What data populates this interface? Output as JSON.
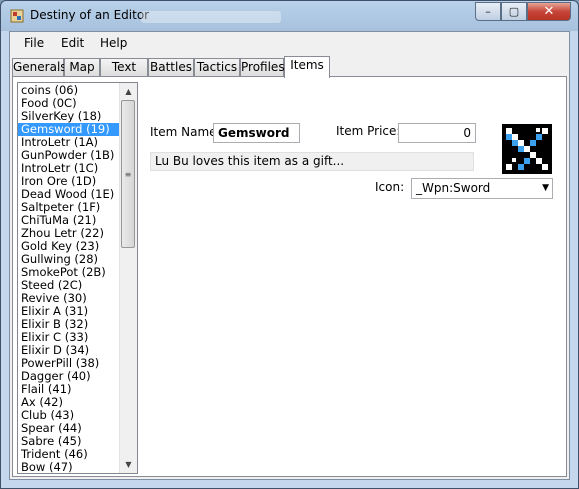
{
  "window": {
    "title": "Destiny of an Editor",
    "controls": {
      "minimize": "–",
      "maximize": "▢",
      "close": "✕"
    }
  },
  "menu": [
    "File",
    "Edit",
    "Help"
  ],
  "tabs": [
    {
      "label": "Generals",
      "active": false
    },
    {
      "label": "Map",
      "active": false
    },
    {
      "label": "Text",
      "active": false
    },
    {
      "label": "Battles",
      "active": false
    },
    {
      "label": "Tactics",
      "active": false
    },
    {
      "label": "Profiles",
      "active": false
    },
    {
      "label": "Items",
      "active": true
    }
  ],
  "items_list": [
    "coins (06)",
    "Food (0C)",
    "SilverKey (18)",
    "Gemsword (19)",
    "IntroLetr (1A)",
    "GunPowder (1B)",
    "IntroLetr (1C)",
    "Iron Ore (1D)",
    "Dead Wood (1E)",
    "Saltpeter (1F)",
    "ChiTuMa (21)",
    "Zhou Letr (22)",
    "Gold Key (23)",
    "Gullwing (28)",
    "SmokePot (2B)",
    "Steed (2C)",
    "Revive (30)",
    "Elixir A (31)",
    "Elixir B (32)",
    "Elixir C (33)",
    "Elixir D (34)",
    "PowerPill (38)",
    "Dagger (40)",
    "Flail (41)",
    "Ax (42)",
    "Club (43)",
    "Spear (44)",
    "Sabre (45)",
    "Trident (46)",
    "Bow (47)"
  ],
  "selected_item": "Gemsword (19)",
  "item_form": {
    "name_label": "Item Name:",
    "name_value": "Gemsword",
    "price_label": "Item Price:",
    "price_value": "0",
    "description": "Lu Bu loves this item as a gift...",
    "icon_label": "Icon:",
    "icon_value": "_Wpn:Sword"
  },
  "colors": {
    "selection": "#3399ff",
    "close_button": "#c7453a"
  }
}
